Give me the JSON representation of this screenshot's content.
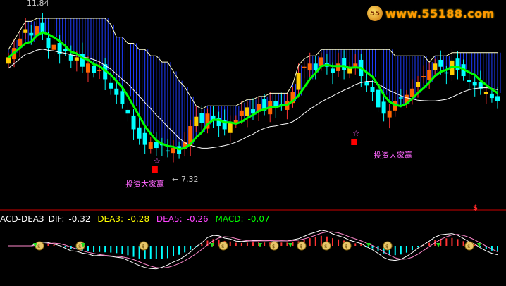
{
  "logo": {
    "text": "www.55188.com",
    "mark": "55"
  },
  "price_high_label": "11.84",
  "price_low_label": "7.32",
  "signal_labels": [
    "投资大家赢",
    "投资大家赢"
  ],
  "macd_legend": {
    "name": "ACD-DEA3",
    "dif_label": "DIF:",
    "dif": "-0.32",
    "dea3_label": "DEA3:",
    "dea3": "-0.28",
    "dea5_label": "DEA5:",
    "dea5": "-0.26",
    "macd_label": "MACD:",
    "macd": "-0.07"
  },
  "dollar_mark": "$",
  "colors": {
    "up": "#ff3333",
    "down": "#00ffff",
    "ma_green": "#00ff00",
    "band": "#1e3cff",
    "envelope": "#ffffcc",
    "dif": "#ffffff",
    "dea3": "#ffff00",
    "dea5": "#ff44ff",
    "macd": "#00ff00",
    "signal": "#ff66ff",
    "divider": "#cc0000",
    "box": "#ff0000"
  },
  "chart_data": {
    "type": "candlestick",
    "price_range": [
      6.8,
      12.3
    ],
    "closes": [
      10.6,
      10.9,
      11.2,
      11.5,
      11.3,
      11.6,
      11.4,
      10.9,
      11.0,
      10.7,
      10.8,
      10.5,
      10.6,
      10.3,
      10.4,
      10.1,
      10.2,
      9.9,
      9.6,
      9.4,
      9.1,
      8.8,
      8.3,
      8.0,
      7.8,
      7.9,
      7.7,
      7.8,
      7.6,
      7.7,
      7.5,
      7.9,
      8.4,
      8.7,
      8.5,
      8.8,
      8.6,
      8.4,
      8.3,
      8.5,
      8.6,
      8.9,
      9.0,
      8.8,
      9.1,
      8.9,
      9.2,
      9.0,
      9.1,
      9.2,
      9.5,
      10.1,
      10.3,
      10.4,
      10.2,
      10.6,
      10.3,
      10.1,
      10.4,
      10.2,
      10.3,
      10.4,
      10.0,
      9.7,
      9.5,
      9.0,
      8.8,
      8.9,
      9.2,
      9.3,
      9.4,
      9.6,
      9.8,
      10.0,
      10.2,
      10.4,
      10.3,
      10.1,
      10.5,
      10.2,
      10.0,
      9.8,
      9.7,
      9.6,
      9.5,
      9.3,
      9.2
    ],
    "high_label": "11.84",
    "low_label": "7.32",
    "indicators": {
      "dif": -0.32,
      "dea3": -0.28,
      "dea5": -0.26,
      "macd": -0.07
    }
  }
}
